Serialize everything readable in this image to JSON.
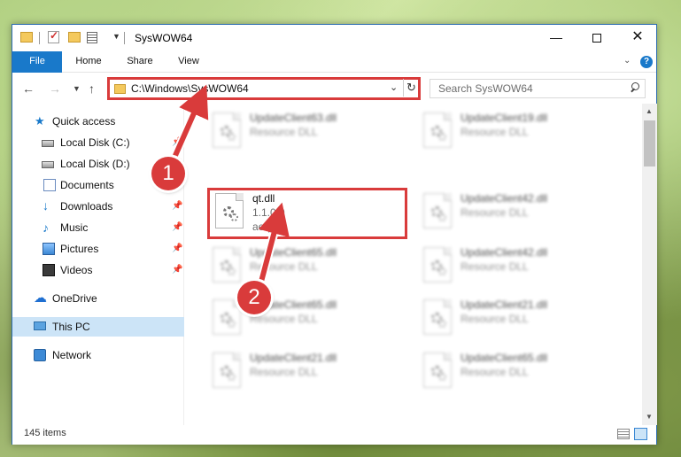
{
  "window": {
    "title": "SysWOW64",
    "controls": {
      "minimize": "—",
      "maximize": "",
      "close": "✕"
    }
  },
  "ribbon": {
    "tabs": [
      "File",
      "Home",
      "Share",
      "View"
    ],
    "help": "?"
  },
  "navbar": {
    "address": "C:\\Windows\\SysWOW64",
    "search_placeholder": "Search SysWOW64"
  },
  "sidebar": {
    "items": [
      {
        "label": "Quick access",
        "icon": "star-icon"
      },
      {
        "label": "Local Disk (C:)",
        "icon": "disk-icon"
      },
      {
        "label": "Local Disk (D:)",
        "icon": "disk-icon"
      },
      {
        "label": "Documents",
        "icon": "documents-icon"
      },
      {
        "label": "Downloads",
        "icon": "downloads-icon"
      },
      {
        "label": "Music",
        "icon": "music-icon"
      },
      {
        "label": "Pictures",
        "icon": "pictures-icon"
      },
      {
        "label": "Videos",
        "icon": "videos-icon"
      },
      {
        "label": "OneDrive",
        "icon": "onedrive-icon"
      },
      {
        "label": "This PC",
        "icon": "pc-icon"
      },
      {
        "label": "Network",
        "icon": "network-icon"
      }
    ]
  },
  "files": [
    {
      "name": "UpdateClient63.dll",
      "line1": "Resource DLL",
      "line2": ""
    },
    {
      "name": "UpdateClient19.dll",
      "line1": "Resource DLL",
      "line2": ""
    },
    {
      "name": "qt.dll",
      "line1": "1.1.0.0",
      "line2": "aeqt3"
    },
    {
      "name": "UpdateClient42.dll",
      "line1": "Resource DLL",
      "line2": ""
    },
    {
      "name": "UpdateClient65.dll",
      "line1": "Resource DLL",
      "line2": ""
    },
    {
      "name": "UpdateClient42.dll",
      "line1": "Resource DLL",
      "line2": ""
    },
    {
      "name": "UpdateClient65.dll",
      "line1": "Resource DLL",
      "line2": ""
    },
    {
      "name": "UpdateClient21.dll",
      "line1": "Resource DLL",
      "line2": ""
    },
    {
      "name": "UpdateClient21.dll",
      "line1": "Resource DLL",
      "line2": ""
    },
    {
      "name": "UpdateClient65.dll",
      "line1": "Resource DLL",
      "line2": ""
    }
  ],
  "status": {
    "item_count": "145 items"
  },
  "annotations": {
    "step1": "1",
    "step2": "2",
    "color": "#d93b3b"
  }
}
